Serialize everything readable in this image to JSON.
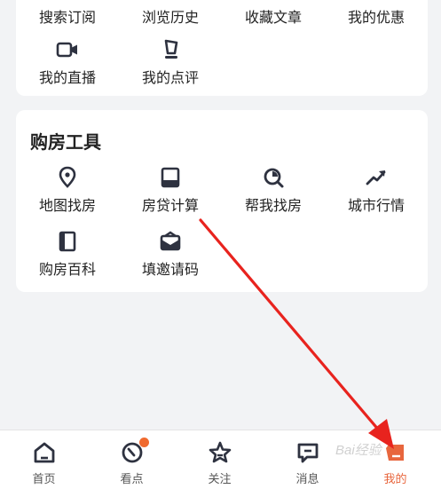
{
  "top_section": {
    "row1": [
      {
        "label": "搜索订阅"
      },
      {
        "label": "浏览历史"
      },
      {
        "label": "收藏文章"
      },
      {
        "label": "我的优惠"
      }
    ],
    "row2": [
      {
        "label": "我的直播",
        "icon": "video-camera-icon"
      },
      {
        "label": "我的点评",
        "icon": "review-pen-icon"
      }
    ]
  },
  "tools_section": {
    "title": "购房工具",
    "items": [
      {
        "label": "地图找房",
        "icon": "map-pin-icon"
      },
      {
        "label": "房贷计算",
        "icon": "calculator-icon"
      },
      {
        "label": "帮我找房",
        "icon": "search-icon"
      },
      {
        "label": "城市行情",
        "icon": "trend-chart-icon"
      },
      {
        "label": "购房百科",
        "icon": "book-icon"
      },
      {
        "label": "填邀请码",
        "icon": "envelope-icon"
      }
    ]
  },
  "tabbar": {
    "tabs": [
      {
        "label": "首页",
        "icon": "home-icon"
      },
      {
        "label": "看点",
        "icon": "discover-icon"
      },
      {
        "label": "关注",
        "icon": "star-icon"
      },
      {
        "label": "消息",
        "icon": "message-icon"
      },
      {
        "label": "我的",
        "icon": "profile-icon"
      }
    ],
    "active_index": 4
  },
  "colors": {
    "accent": "#e8663d",
    "icon_dark": "#2e3240",
    "annotation_arrow": "#e8231e"
  },
  "watermark": "Bai经验"
}
